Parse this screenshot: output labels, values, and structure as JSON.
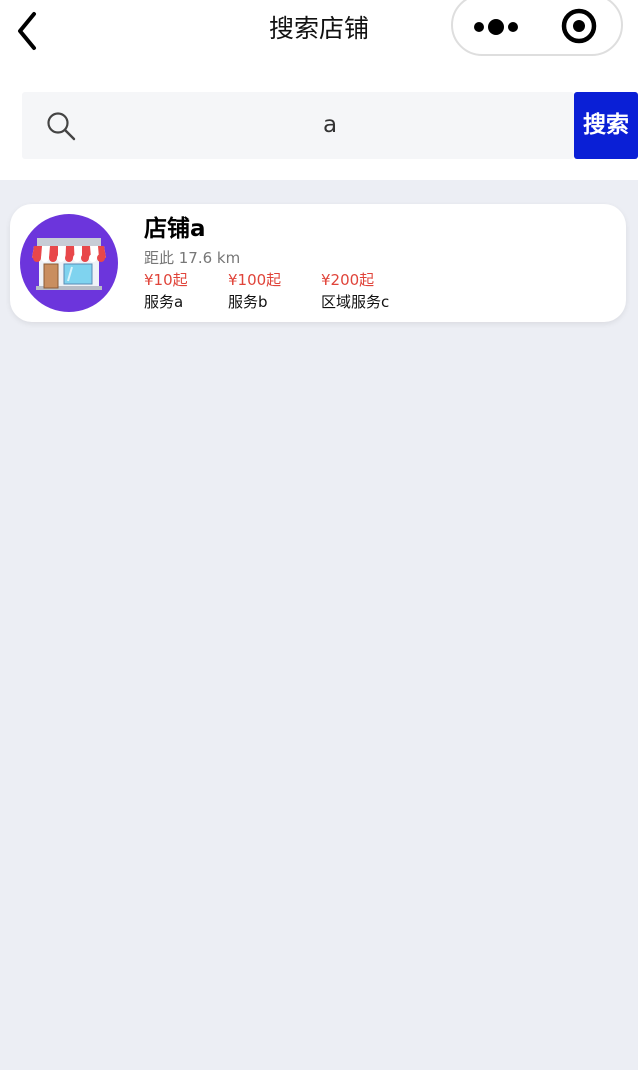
{
  "nav": {
    "title": "搜索店铺"
  },
  "search": {
    "value": "a",
    "button_label": "搜索"
  },
  "results": [
    {
      "name": "店铺a",
      "distance": "距此 17.6 km",
      "services": [
        {
          "price": "¥10起",
          "name": "服务a"
        },
        {
          "price": "¥100起",
          "name": "服务b"
        },
        {
          "price": "¥200起",
          "name": "区域服务c"
        }
      ]
    }
  ],
  "colors": {
    "accent": "#0a1fd6",
    "price": "#e0443a",
    "avatar_bg": "#6c35dc",
    "page_bg": "#eceef4"
  },
  "icons": [
    "back-arrow-icon",
    "more-dots-icon",
    "close-target-icon",
    "search-icon",
    "store-icon"
  ]
}
